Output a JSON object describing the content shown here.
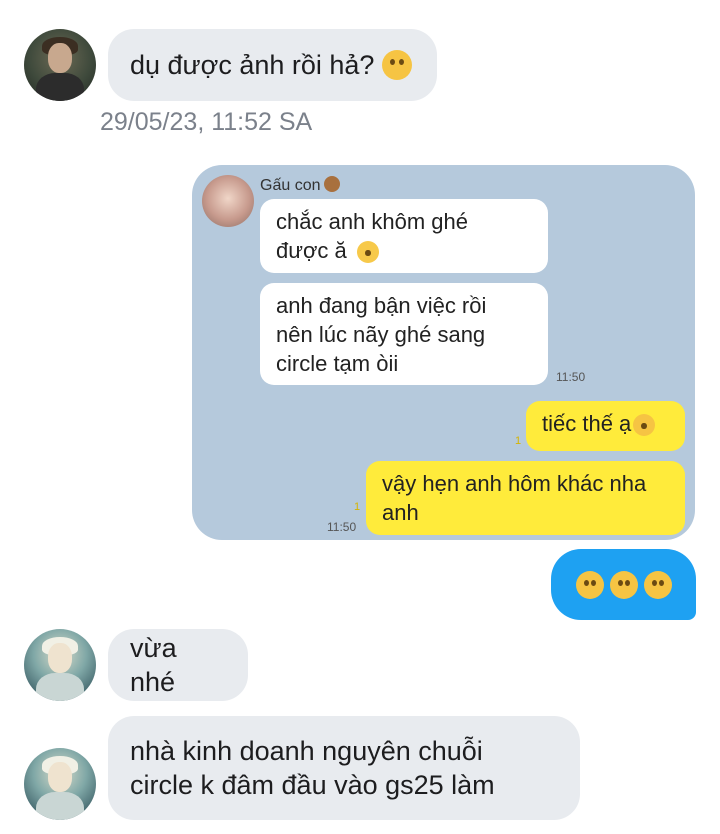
{
  "messages": {
    "m1": "dụ được ảnh rồi hả?",
    "m1_emoji": "thinking-face",
    "timestamp": "29/05/23, 11:52 SA",
    "m3": "vừa nhé",
    "m4_line1": "nhà kinh doanh nguyên chuỗi",
    "m4_line2": "circle k đâm đầu vào gs25 làm"
  },
  "screenshot": {
    "sender_name": "Gấu con",
    "sender_emoji": "teddy-bear",
    "bubble1_line1": "chắc anh khôm ghé",
    "bubble1_line2": "được ă",
    "bubble2_line1": "anh đang bận việc rồi",
    "bubble2_line2": "nên lúc nãy ghé sang",
    "bubble2_line3": "circle tạm òii",
    "time1": "11:50",
    "reply1": "tiếc thế ạ",
    "reply1_read": "1",
    "reply2_line1": "vậy hẹn anh hôm khác nha",
    "reply2_line2": "anh",
    "reply2_read": "1",
    "time2": "11:50"
  },
  "outgoing": {
    "emojis": [
      "upside-down-face",
      "upside-down-face",
      "upside-down-face"
    ]
  },
  "colors": {
    "incoming_bubble": "#e8ebef",
    "outgoing_bubble": "#1ea1f2",
    "screenshot_bg": "#b5c9dc",
    "screenshot_yellow": "#ffeb3b"
  }
}
